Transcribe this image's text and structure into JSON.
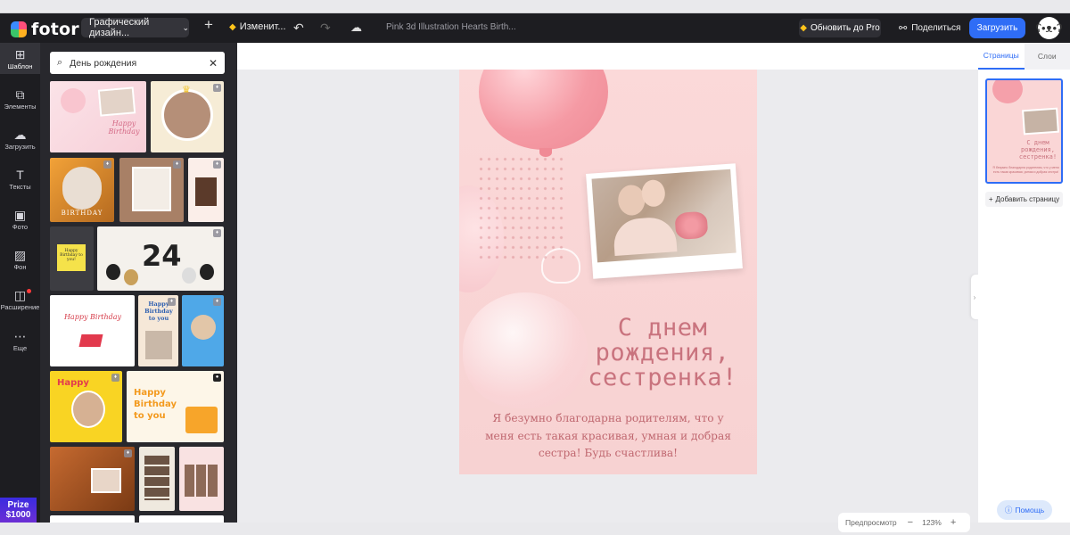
{
  "app": {
    "logo_text": "fotor"
  },
  "topbar": {
    "design_type": "Графический дизайн...",
    "resize_label": "Изменит...",
    "doc_title": "Pink 3d Illustration Hearts Birth...",
    "pro_label": "Обновить до Pro",
    "share_label": "Поделиться",
    "download_label": "Загрузить"
  },
  "rail": {
    "items": [
      {
        "label": "Шаблон",
        "icon": "template-icon"
      },
      {
        "label": "Элементы",
        "icon": "elements-icon"
      },
      {
        "label": "Загрузить",
        "icon": "upload-icon"
      },
      {
        "label": "Тексты",
        "icon": "text-icon"
      },
      {
        "label": "Фото",
        "icon": "photo-icon"
      },
      {
        "label": "Фон",
        "icon": "background-icon"
      },
      {
        "label": "Расширение",
        "icon": "extension-icon"
      },
      {
        "label": "Еще",
        "icon": "more-icon"
      }
    ],
    "prize_line1": "Prize",
    "prize_line2": "$1000"
  },
  "templates": {
    "search_value": "День рождения",
    "thumbs": [
      {
        "text": "Happy Birthday"
      },
      {
        "text": ""
      },
      {
        "text": "BIRTHDAY"
      },
      {
        "text": ""
      },
      {
        "text": ""
      },
      {
        "text": "Happy Birthday to you!"
      },
      {
        "text": "24"
      },
      {
        "text": "Happy Birthday"
      },
      {
        "text": "Happy Birthday to you"
      },
      {
        "text": ""
      },
      {
        "text": "Happy"
      },
      {
        "text": "Happy Birthday to you"
      },
      {
        "text": ""
      },
      {
        "text": ""
      },
      {
        "text": ""
      }
    ]
  },
  "canvas": {
    "headline": [
      "С днем",
      "рождения,",
      "сестренка!"
    ],
    "body": "Я безумно благодарна родителям, что у меня есть такая красивая, умная и добрая сестра! Будь счастлива!"
  },
  "zoom": {
    "preview_label": "Предпросмотр",
    "minus": "−",
    "value": "123%",
    "plus": "+"
  },
  "right_panel": {
    "tab_pages": "Страницы",
    "tab_layers": "Слои",
    "add_page_label": "Добавить страницу",
    "help_label": "Помощь",
    "thumb_headline": "С днем рождения, сестренка!",
    "thumb_body": "Я безумно благодарна родителям, что у меня есть такая красивая, умная и добрая сестра!"
  },
  "colors": {
    "accent": "#2f6df6",
    "topbar": "#1d1d21",
    "headline": "#c9737e",
    "page_bg": "#fbd9d9"
  }
}
